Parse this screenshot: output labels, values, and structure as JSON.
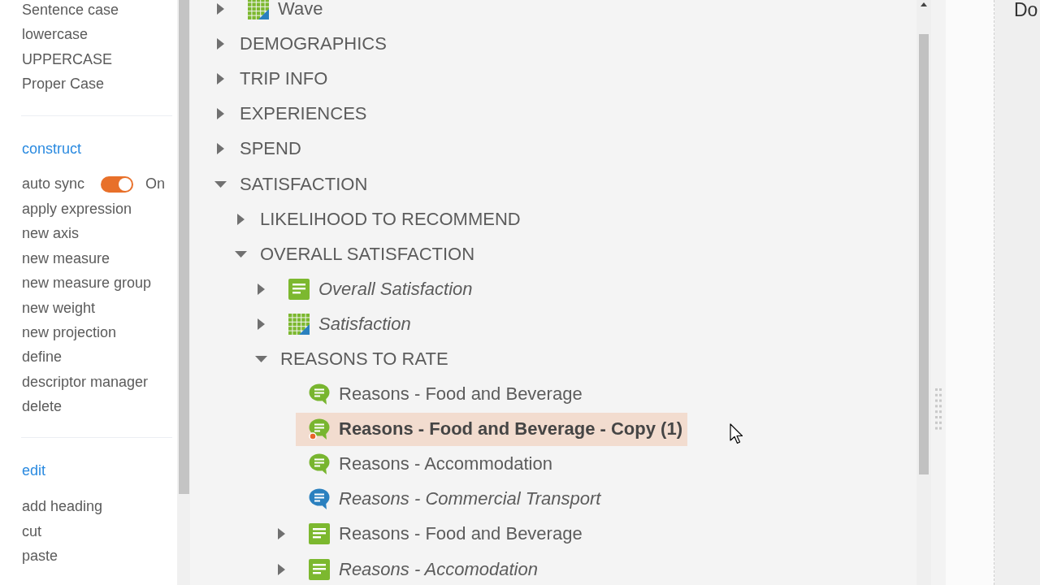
{
  "sidebar": {
    "sections": [
      {
        "items": [
          {
            "kind": "action",
            "label": "Sentence case"
          },
          {
            "kind": "action",
            "label": "lowercase"
          },
          {
            "kind": "action",
            "label": "UPPERCASE"
          },
          {
            "kind": "action",
            "label": "Proper Case"
          }
        ]
      },
      {
        "heading": "construct",
        "items": [
          {
            "kind": "toggle",
            "label": "auto sync",
            "on": true,
            "state_label": "On"
          },
          {
            "kind": "action",
            "label": "apply expression"
          },
          {
            "kind": "action",
            "label": "new axis"
          },
          {
            "kind": "action",
            "label": "new measure"
          },
          {
            "kind": "action",
            "label": "new measure group"
          },
          {
            "kind": "action",
            "label": "new weight"
          },
          {
            "kind": "action",
            "label": "new projection"
          },
          {
            "kind": "action",
            "label": "define"
          },
          {
            "kind": "action",
            "label": "descriptor manager"
          },
          {
            "kind": "action",
            "label": "delete"
          }
        ]
      },
      {
        "heading": "edit",
        "items": [
          {
            "kind": "action",
            "label": "add heading"
          },
          {
            "kind": "action",
            "label": "cut"
          },
          {
            "kind": "action",
            "label": "paste"
          }
        ]
      }
    ]
  },
  "tree": {
    "nodes": [
      {
        "label": "Wave",
        "kind": "grid",
        "expanded": false,
        "italic": false,
        "selected": false
      },
      {
        "label": "DEMOGRAPHICS",
        "kind": "folder",
        "expanded": false,
        "selected": false
      },
      {
        "label": "TRIP INFO",
        "kind": "folder",
        "expanded": false,
        "selected": false
      },
      {
        "label": "EXPERIENCES",
        "kind": "folder",
        "expanded": false,
        "selected": false
      },
      {
        "label": "SPEND",
        "kind": "folder",
        "expanded": false,
        "selected": false
      },
      {
        "label": "SATISFACTION",
        "kind": "folder",
        "expanded": true,
        "selected": false,
        "children": [
          {
            "label": "LIKELIHOOD TO RECOMMEND",
            "kind": "folder",
            "expanded": false,
            "selected": false
          },
          {
            "label": "OVERALL SATISFACTION",
            "kind": "folder",
            "expanded": true,
            "selected": false,
            "children": [
              {
                "label": "Overall Satisfaction",
                "kind": "doc",
                "expanded": false,
                "italic": true,
                "selected": false
              },
              {
                "label": "Satisfaction",
                "kind": "grid",
                "expanded": false,
                "italic": true,
                "selected": false
              },
              {
                "label": "REASONS TO RATE",
                "kind": "folder",
                "expanded": true,
                "selected": false,
                "children": [
                  {
                    "label": "Reasons - Food and Beverage",
                    "kind": "comment",
                    "color": "#78b52f",
                    "flagged": false,
                    "italic": false,
                    "selected": false
                  },
                  {
                    "label": "Reasons - Food and Beverage - Copy (1)",
                    "kind": "comment",
                    "color": "#78b52f",
                    "flagged": true,
                    "italic": false,
                    "selected": true
                  },
                  {
                    "label": "Reasons - Accommodation",
                    "kind": "comment",
                    "color": "#78b52f",
                    "flagged": false,
                    "italic": false,
                    "selected": false
                  },
                  {
                    "label": "Reasons - Commercial Transport",
                    "kind": "comment",
                    "color": "#2a80bf",
                    "flagged": false,
                    "italic": true,
                    "selected": false
                  },
                  {
                    "label": "Reasons - Food and Beverage",
                    "kind": "doc",
                    "expanded": false,
                    "flagged": false,
                    "italic": false,
                    "selected": false
                  },
                  {
                    "label": "Reasons - Accomodation",
                    "kind": "doc",
                    "expanded": false,
                    "flagged": false,
                    "italic": true,
                    "selected": false
                  }
                ]
              }
            ]
          }
        ]
      }
    ]
  },
  "right_panel": {
    "title": "Do"
  }
}
